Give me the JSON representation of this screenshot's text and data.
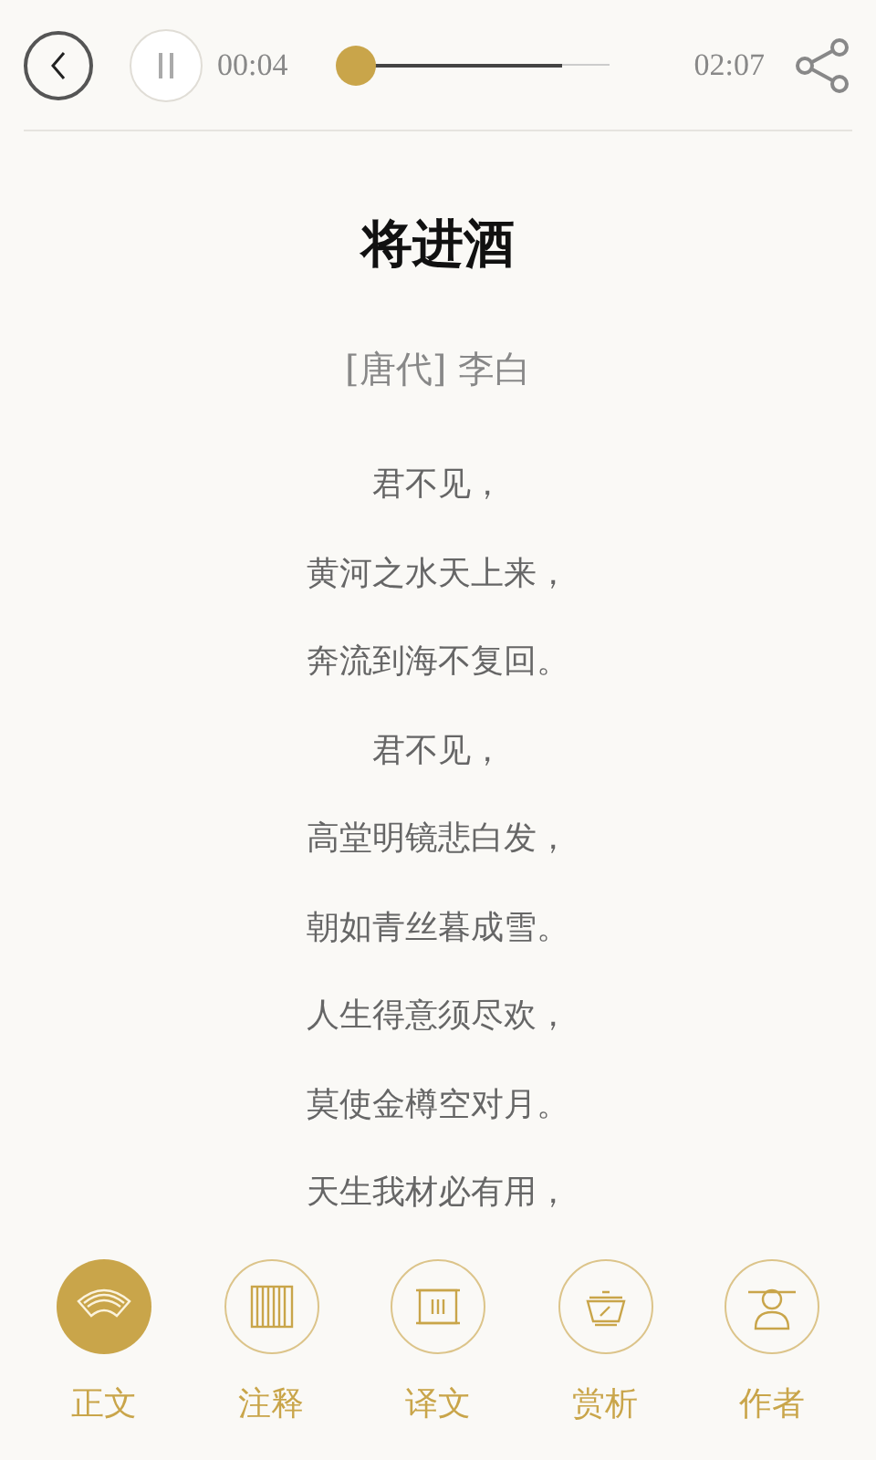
{
  "player": {
    "playing": true,
    "elapsed": "00:04",
    "duration": "02:07",
    "level": 0.03
  },
  "poem": {
    "title": "将进酒",
    "author": "[唐代] 李白",
    "lines": [
      {
        "text": "君不见，",
        "faded": false
      },
      {
        "text": "黄河之水天上来，",
        "faded": false
      },
      {
        "text": "奔流到海不复回。",
        "faded": false
      },
      {
        "text": "君不见，",
        "faded": false
      },
      {
        "text": "高堂明镜悲白发，",
        "faded": false
      },
      {
        "text": "朝如青丝暮成雪。",
        "faded": false
      },
      {
        "text": "人生得意须尽欢，",
        "faded": false
      },
      {
        "text": "莫使金樽空对月。",
        "faded": false
      },
      {
        "text": "天生我材必有用，",
        "faded": false
      }
    ]
  },
  "tabs": [
    {
      "label": "正文",
      "kind": "fan",
      "selected": true
    },
    {
      "label": "注释",
      "kind": "scroll",
      "selected": false
    },
    {
      "label": "译文",
      "kind": "frame",
      "selected": false
    },
    {
      "label": "赏析",
      "kind": "bowl",
      "selected": false
    },
    {
      "label": "作者",
      "kind": "person",
      "selected": false
    }
  ]
}
